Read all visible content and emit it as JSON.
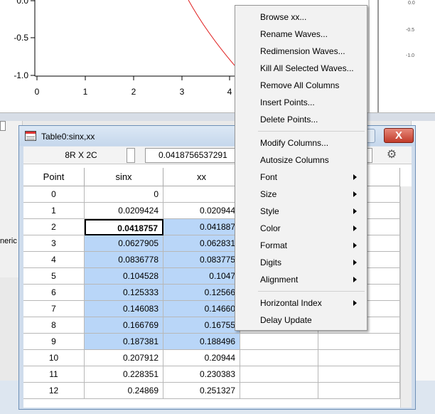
{
  "graph": {
    "y_ticks": [
      "0.0",
      "-0.5",
      "-1.0"
    ],
    "x_ticks": [
      "0",
      "1",
      "2",
      "3",
      "4"
    ],
    "right_ticks": [
      "0.0",
      "-0.5",
      "-1.0"
    ],
    "curve_color": "#e02020"
  },
  "left_panel": {
    "text": "neric"
  },
  "table_window": {
    "title": "Table0:sinx,xx",
    "close_label": "X",
    "dimensions": "8R X 2C",
    "value_field": "0.0418756537291",
    "columns": [
      "Point",
      "sinx",
      "xx"
    ],
    "rows": [
      [
        "0",
        "0",
        ""
      ],
      [
        "1",
        "0.0209424",
        "0.020944"
      ],
      [
        "2",
        "0.0418757",
        "0.041887"
      ],
      [
        "3",
        "0.0627905",
        "0.062831"
      ],
      [
        "4",
        "0.0836778",
        "0.083775"
      ],
      [
        "5",
        "0.104528",
        "0.1047"
      ],
      [
        "6",
        "0.125333",
        "0.12566"
      ],
      [
        "7",
        "0.146083",
        "0.14660"
      ],
      [
        "8",
        "0.166769",
        "0.16755"
      ],
      [
        "9",
        "0.187381",
        "0.188496"
      ],
      [
        "10",
        "0.207912",
        "0.20944"
      ],
      [
        "11",
        "0.228351",
        "0.230383"
      ],
      [
        "12",
        "0.24869",
        "0.251327"
      ]
    ],
    "selection_color": "#b9d6f8"
  },
  "context_menu": {
    "items": [
      {
        "label": "Browse xx...",
        "submenu": false
      },
      {
        "label": "Rename Waves...",
        "submenu": false
      },
      {
        "label": "Redimension Waves...",
        "submenu": false
      },
      {
        "label": "Kill All Selected Waves...",
        "submenu": false
      },
      {
        "label": "Remove All Columns",
        "submenu": false
      },
      {
        "label": "Insert Points...",
        "submenu": false
      },
      {
        "label": "Delete Points...",
        "submenu": false
      },
      {
        "label": "Modify Columns...",
        "submenu": false
      },
      {
        "label": "Autosize Columns",
        "submenu": false
      },
      {
        "label": "Font",
        "submenu": true
      },
      {
        "label": "Size",
        "submenu": true
      },
      {
        "label": "Style",
        "submenu": true
      },
      {
        "label": "Color",
        "submenu": true
      },
      {
        "label": "Format",
        "submenu": true
      },
      {
        "label": "Digits",
        "submenu": true
      },
      {
        "label": "Alignment",
        "submenu": true
      },
      {
        "label": "Horizontal Index",
        "submenu": true
      },
      {
        "label": "Delay Update",
        "submenu": false
      }
    ]
  }
}
